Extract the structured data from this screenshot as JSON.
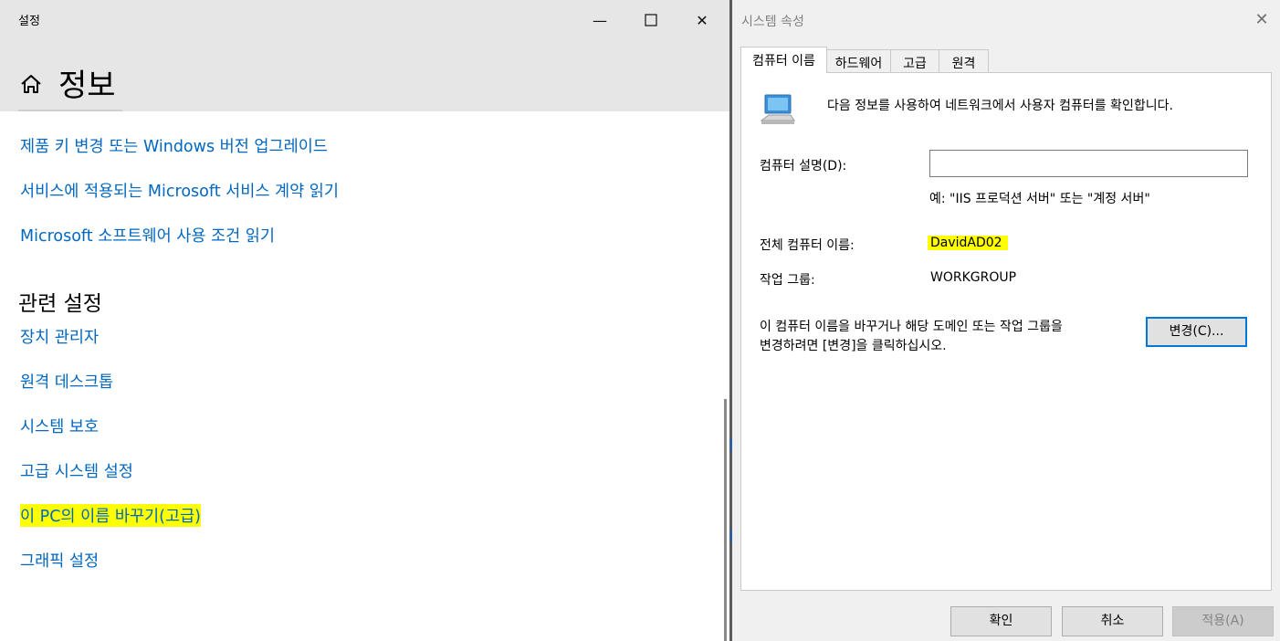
{
  "settings": {
    "app_title": "설정",
    "minimize_glyph": "—",
    "maximize_glyph": "☐",
    "close_glyph": "✕",
    "page_title": "정보",
    "home_icon": "home-icon",
    "links_top": [
      "제품 키 변경 또는 Windows 버전 업그레이드",
      "서비스에 적용되는 Microsoft 서비스 계약 읽기",
      "Microsoft 소프트웨어 사용 조건 읽기"
    ],
    "related_heading": "관련 설정",
    "related_links": [
      "장치 관리자",
      "원격 데스크톱",
      "시스템 보호",
      "고급 시스템 설정",
      "이 PC의 이름 바꾸기(고급)",
      "그래픽 설정"
    ],
    "link_color": "#0067c0",
    "highlight_color": "#ffff00"
  },
  "dialog": {
    "title": "시스템 속성",
    "close_glyph": "✕",
    "tabs": [
      "컴퓨터 이름",
      "하드웨어",
      "고급",
      "원격"
    ],
    "active_tab": "컴퓨터 이름",
    "computer_icon": "computer-icon",
    "intro": "다음 정보를 사용하여 네트워크에서 사용자 컴퓨터를 확인합니다.",
    "description_label": "컴퓨터 설명(D):",
    "description_value": "",
    "description_example": "예: \"IIS 프로덕션 서버\" 또는 \"계정 서버\"",
    "full_name_label": "전체 컴퓨터 이름:",
    "full_name_value": "DavidAD02",
    "workgroup_label": "작업 그룹:",
    "workgroup_value": "WORKGROUP",
    "rename_text_line1": "이 컴퓨터 이름을 바꾸거나 해당 도메인 또는 작업 그룹을",
    "rename_text_line2": "변경하려면 [변경]을 클릭하십시오.",
    "change_button": "변경(C)...",
    "ok_button": "확인",
    "cancel_button": "취소",
    "apply_button": "적용(A)",
    "focus_color": "#0078d7"
  }
}
